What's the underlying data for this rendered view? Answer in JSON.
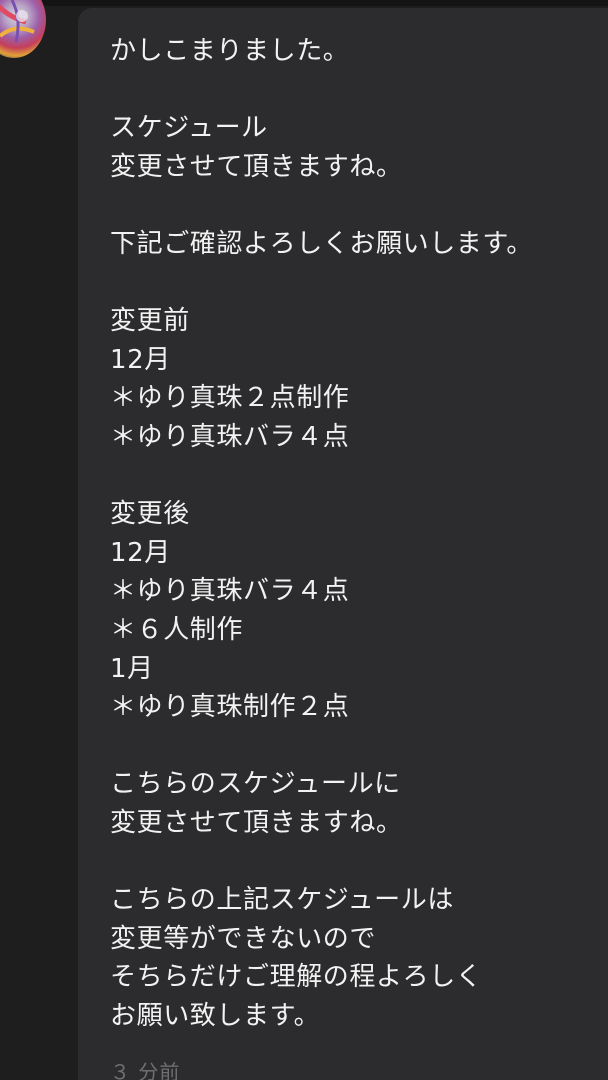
{
  "message": {
    "text": "かしこまりました。\n\nスケジュール\n変更させて頂きますね。\n\n下記ご確認よろしくお願いします。\n\n変更前\n12月\n＊ゆり真珠２点制作\n＊ゆり真珠バラ４点\n\n変更後\n12月\n＊ゆり真珠バラ４点\n＊６人制作\n1月\n＊ゆり真珠制作２点\n\nこちらのスケジュールに\n変更させて頂きますね。\n\nこちらの上記スケジュールは\n変更等ができないので\nそちらだけご理解の程よろしく\nお願い致します。",
    "timestamp": "３ 分前"
  },
  "colors": {
    "background": "#1e1e1f",
    "bubble": "#2c2c2e",
    "text": "#f2f2f2",
    "timestamp": "#6f6f73"
  },
  "icons": {
    "avatar": "avatar-image"
  }
}
